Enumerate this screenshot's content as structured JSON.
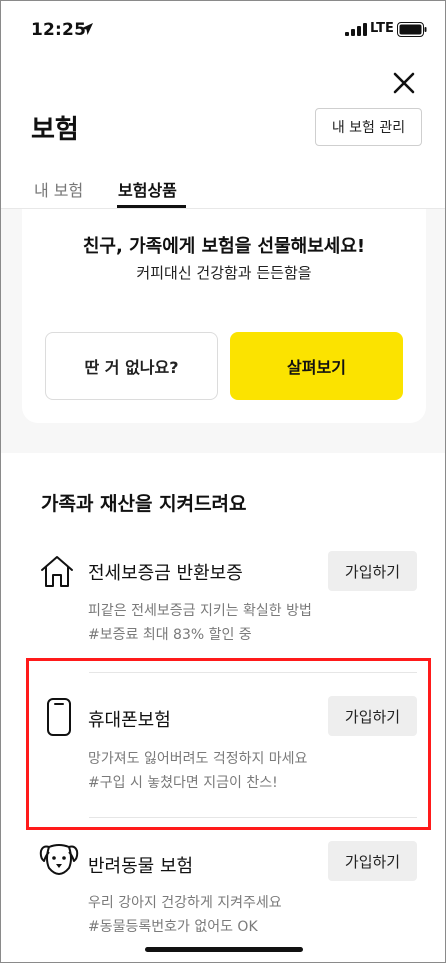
{
  "status_bar": {
    "time": "12:25",
    "network": "LTE"
  },
  "header": {
    "title": "보험",
    "manage_button": "내 보험 관리"
  },
  "tabs": [
    {
      "label": "내 보험",
      "active": false
    },
    {
      "label": "보험상품",
      "active": true
    }
  ],
  "gift_card": {
    "title": "친구, 가족에게 보험을 선물해보세요!",
    "subtitle": "커피대신 건강함과 든든함을",
    "no_button": "딴 거 없나요?",
    "look_button": "살펴보기",
    "accent_color": "#FBE300"
  },
  "section": {
    "title": "가족과 재산을 지켜드려요",
    "products": [
      {
        "icon": "house-icon",
        "title": "전세보증금 반환보증",
        "desc_lines": [
          "피같은 전세보증금 지키는 확실한 방법",
          "#보증료 최대 83% 할인 중"
        ],
        "button": "가입하기"
      },
      {
        "icon": "smartphone-icon",
        "title": "휴대폰보험",
        "desc_lines": [
          "망가져도 잃어버려도 걱정하지 마세요",
          "#구입 시 놓쳤다면 지금이 찬스!"
        ],
        "button": "가입하기",
        "highlighted": true
      },
      {
        "icon": "dog-icon",
        "title": "반려동물 보험",
        "desc_lines": [
          "우리 강아지 건강하게 지켜주세요",
          "#동물등록번호가 없어도 OK"
        ],
        "button": "가입하기"
      }
    ]
  },
  "highlight_color": "#FF1A1A"
}
